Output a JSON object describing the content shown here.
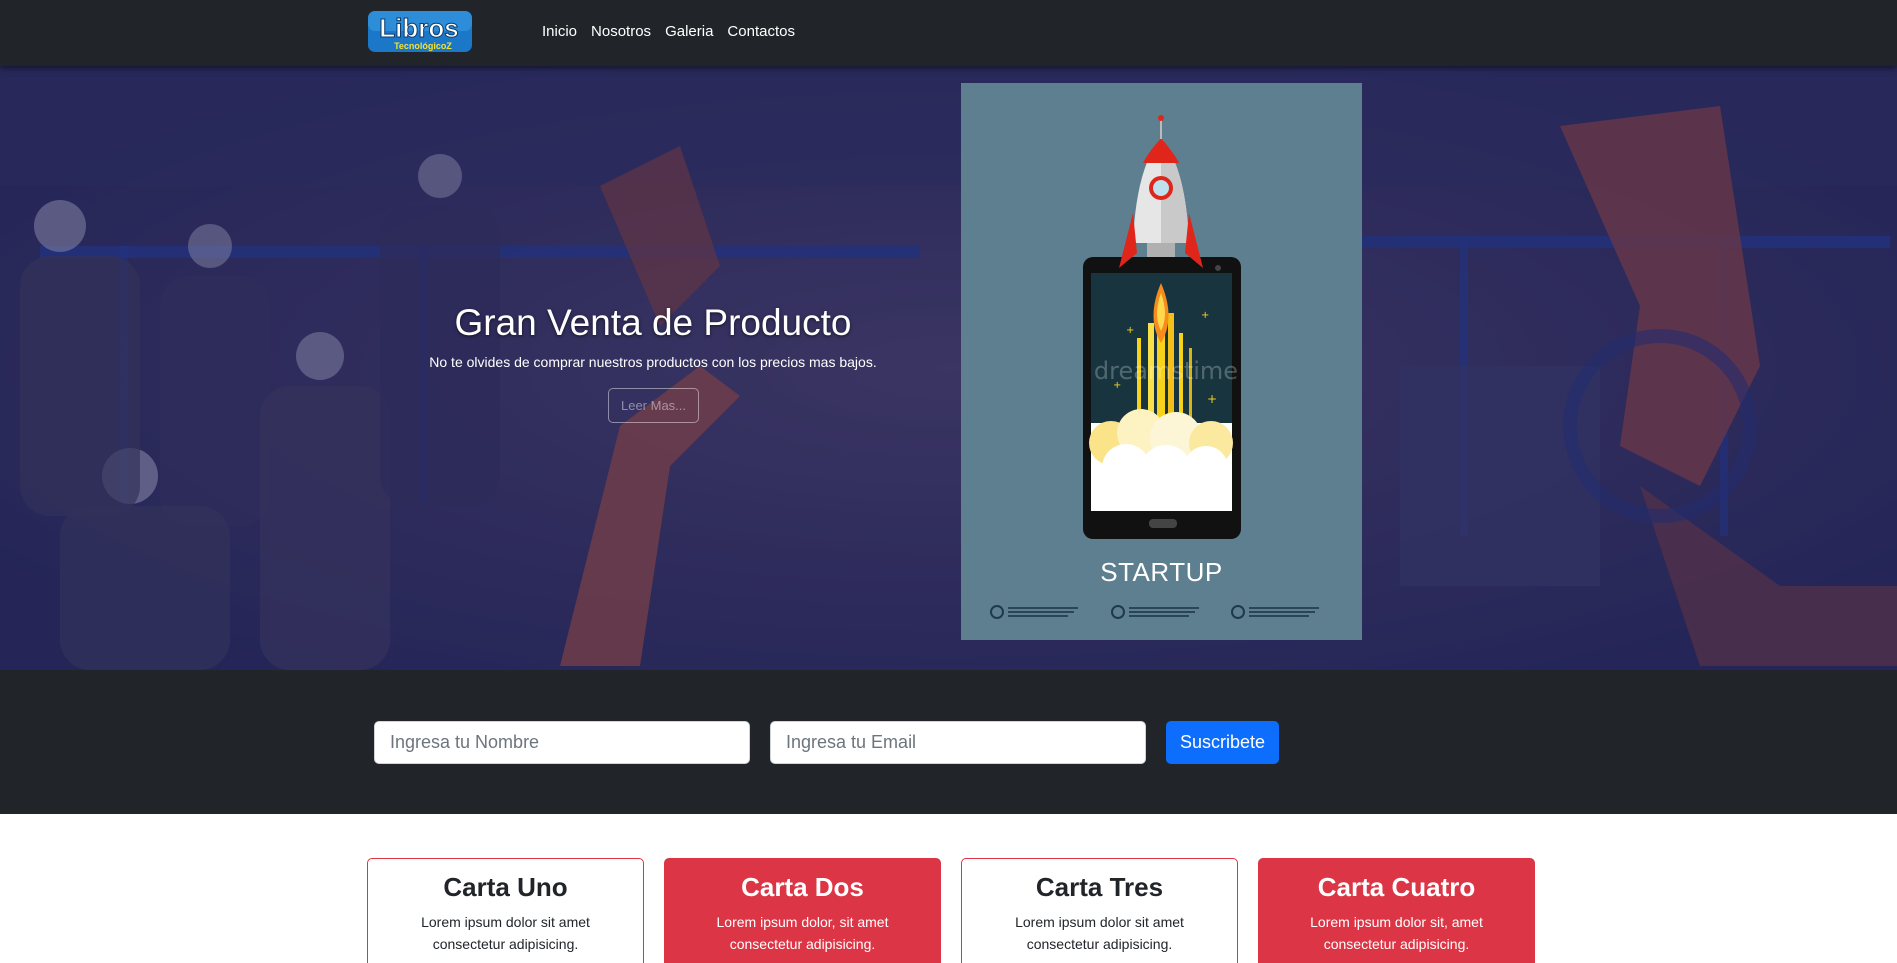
{
  "brand": {
    "logo_title": "Libros",
    "logo_subtitle": "TecnológicoZ"
  },
  "nav": {
    "items": [
      "Inicio",
      "Nosotros",
      "Galeria",
      "Contactos"
    ]
  },
  "hero": {
    "title": "Gran Venta de Producto",
    "text": "No te olvides de comprar nuestros productos con los precios mas bajos.",
    "button_label": "Leer Mas...",
    "poster_title": "STARTUP",
    "poster_watermark": "dreamstime"
  },
  "subscribe": {
    "name_placeholder": "Ingresa tu Nombre",
    "email_placeholder": "Ingresa tu Email",
    "button_label": "Suscribete"
  },
  "cards": [
    {
      "title": "Carta Uno",
      "text": "Lorem ipsum dolor sit amet consectetur adipisicing.",
      "style": "outline"
    },
    {
      "title": "Carta Dos",
      "text": "Lorem ipsum dolor, sit amet consectetur adipisicing.",
      "style": "red"
    },
    {
      "title": "Carta Tres",
      "text": "Lorem ipsum dolor sit amet consectetur adipisicing.",
      "style": "outline"
    },
    {
      "title": "Carta Cuatro",
      "text": "Lorem ipsum dolor sit, amet consectetur adipisicing.",
      "style": "red"
    }
  ],
  "colors": {
    "navbar": "#212529",
    "primary": "#0d6efd",
    "danger": "#dc3545",
    "poster_bg": "#5d7f8f"
  }
}
